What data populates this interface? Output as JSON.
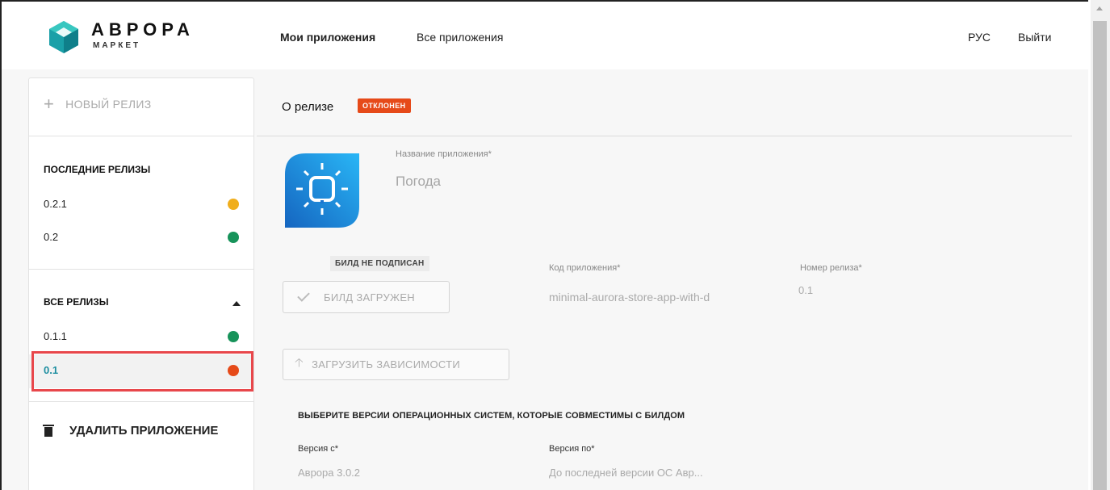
{
  "header": {
    "logo_title": "АВРОРА",
    "logo_subtitle": "МАРКЕТ",
    "nav": {
      "my_apps": "Мои приложения",
      "all_apps": "Все приложения",
      "lang": "РУС",
      "logout": "Выйти"
    }
  },
  "sidebar": {
    "new_release": "НОВЫЙ РЕЛИЗ",
    "recent_title": "ПОСЛЕДНИЕ РЕЛИЗЫ",
    "recent": [
      {
        "version": "0.2.1",
        "status_color": "#f0ae1c"
      },
      {
        "version": "0.2",
        "status_color": "#17935a"
      }
    ],
    "all_title": "ВСЕ РЕЛИЗЫ",
    "all": [
      {
        "version": "0.1.1",
        "status_color": "#17935a"
      },
      {
        "version": "0.1",
        "status_color": "#e64a19",
        "selected": true
      }
    ],
    "delete_app": "УДАЛИТЬ ПРИЛОЖЕНИЕ"
  },
  "main": {
    "title": "О релизе",
    "status_badge": "ОТКЛОНЕН",
    "app_name_label": "Название приложения*",
    "app_name_value": "Погода",
    "build_unsigned": "БИЛД НЕ ПОДПИСАН",
    "build_uploaded": "БИЛД ЗАГРУЖЕН",
    "app_code_label": "Код приложения*",
    "app_code_value": "minimal-aurora-store-app-with-d",
    "release_number_label": "Номер релиза*",
    "release_number_value": "0.1",
    "upload_deps": "ЗАГРУЗИТЬ ЗАВИСИМОСТИ",
    "os_title": "ВЫБЕРИТЕ ВЕРСИИ ОПЕРАЦИОННЫХ СИСТЕМ, КОТОРЫЕ СОВМЕСТИМЫ С БИЛДОМ",
    "version_from_label": "Версия с*",
    "version_from_value": "Аврора 3.0.2",
    "version_to_label": "Версия по*",
    "version_to_value": "До последней версии ОС Авр..."
  },
  "colors": {
    "accent": "#1d8ea0",
    "rejected": "#e64a19",
    "highlight": "#e8474b"
  }
}
